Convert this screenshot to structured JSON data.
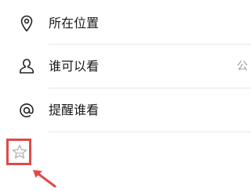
{
  "settings": {
    "items": [
      {
        "icon": "location-pin-icon",
        "label": "所在位置",
        "value": ""
      },
      {
        "icon": "person-icon",
        "label": "谁可以看",
        "value": "公"
      },
      {
        "icon": "at-sign-icon",
        "label": "提醒谁看",
        "value": ""
      }
    ]
  },
  "annotation": {
    "highlight_color": "#e04a4a",
    "highlighted_icon": "star-icon"
  }
}
